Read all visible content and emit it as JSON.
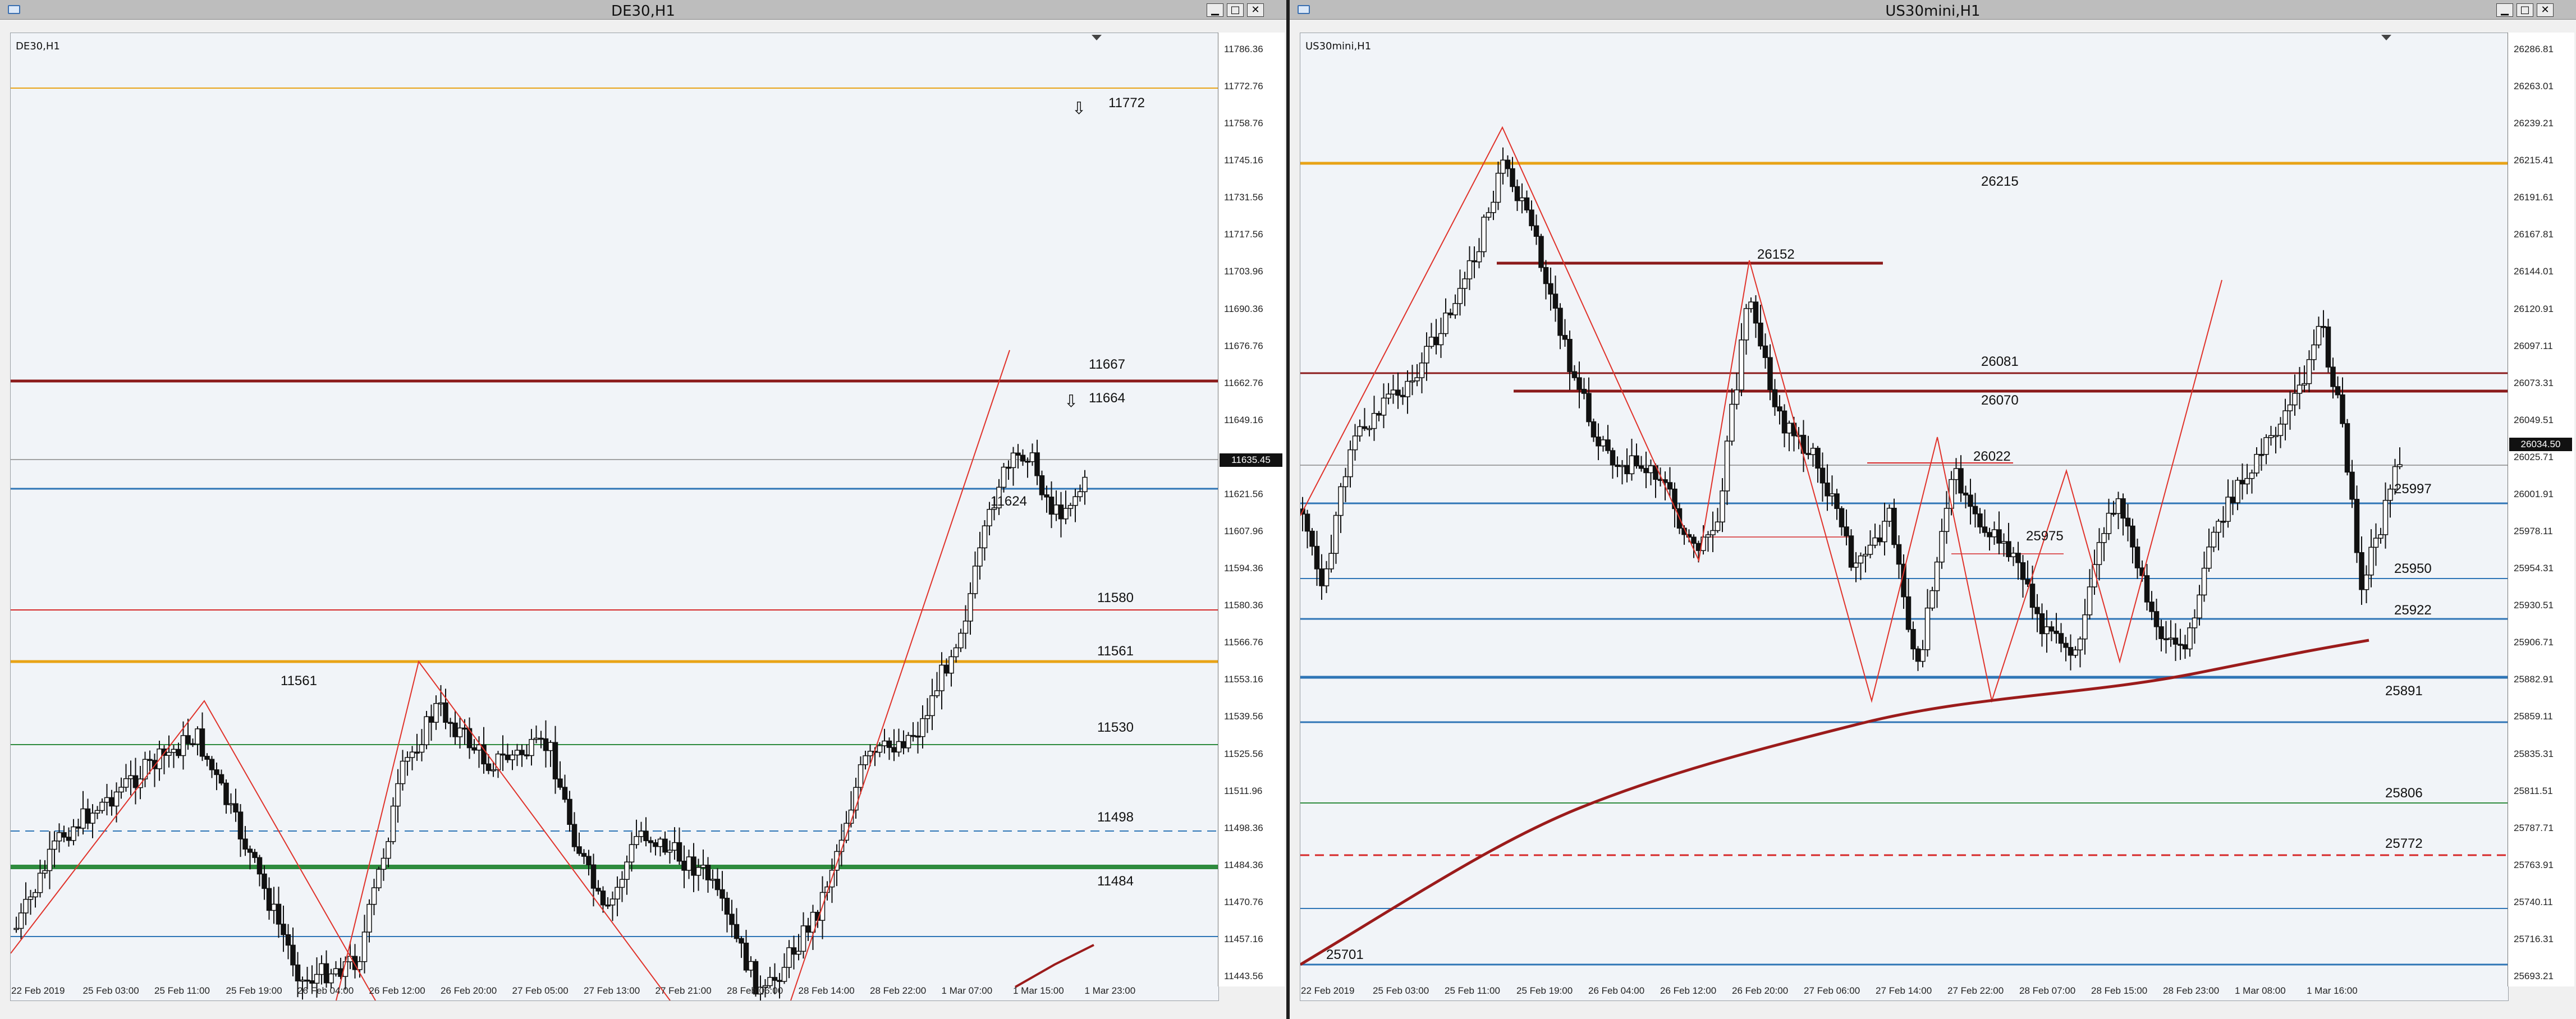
{
  "left": {
    "window_title": "DE30,H1",
    "symbol_label": "DE30,H1",
    "current_price": "11635.45",
    "price_ticks": [
      "11786.36",
      "11772.76",
      "11758.76",
      "11745.16",
      "11731.56",
      "11717.56",
      "11703.96",
      "11690.36",
      "11676.76",
      "11662.76",
      "11649.16",
      "11635.45",
      "11621.56",
      "11607.96",
      "11594.36",
      "11580.36",
      "11566.76",
      "11553.16",
      "11539.56",
      "11525.56",
      "11511.96",
      "11498.36",
      "11484.36",
      "11470.76",
      "11457.16",
      "11443.56"
    ],
    "time_ticks": [
      "22 Feb 2019",
      "25 Feb 03:00",
      "25 Feb 11:00",
      "25 Feb 19:00",
      "26 Feb 04:00",
      "26 Feb 12:00",
      "26 Feb 20:00",
      "27 Feb 05:00",
      "27 Feb 13:00",
      "27 Feb 21:00",
      "28 Feb 06:00",
      "28 Feb 14:00",
      "28 Feb 22:00",
      "1 Mar 07:00",
      "1 Mar 15:00",
      "1 Mar 23:00"
    ],
    "levels": [
      "11772",
      "11667",
      "11664",
      "11624",
      "11580",
      "11561",
      "11561",
      "11530",
      "11498",
      "11484"
    ],
    "colors": {
      "orange": "#e8a317",
      "darkred": "#8b1a1a",
      "red": "#d62728",
      "blue": "#2e75b6",
      "green": "#2e8b3e"
    }
  },
  "right": {
    "window_title": "US30mini,H1",
    "symbol_label": "US30mini,H1",
    "current_price": "26034.50",
    "price_ticks": [
      "26286.81",
      "26263.01",
      "26239.21",
      "26215.41",
      "26191.61",
      "26167.81",
      "26144.01",
      "26120.91",
      "26097.11",
      "26073.31",
      "26049.51",
      "26025.71",
      "26001.91",
      "25978.11",
      "25954.31",
      "25930.51",
      "25906.71",
      "25882.91",
      "25859.11",
      "25835.31",
      "25811.51",
      "25787.71",
      "25763.91",
      "25740.11",
      "25716.31",
      "25693.21"
    ],
    "time_ticks": [
      "22 Feb 2019",
      "25 Feb 03:00",
      "25 Feb 11:00",
      "25 Feb 19:00",
      "26 Feb 04:00",
      "26 Feb 12:00",
      "26 Feb 20:00",
      "27 Feb 06:00",
      "27 Feb 14:00",
      "27 Feb 22:00",
      "28 Feb 07:00",
      "28 Feb 15:00",
      "28 Feb 23:00",
      "1 Mar 08:00",
      "1 Mar 16:00"
    ],
    "levels": [
      "26215",
      "26152",
      "26081",
      "26070",
      "26022",
      "25975",
      "25997",
      "25950",
      "25922",
      "25891",
      "25806",
      "25772",
      "25701"
    ]
  }
}
